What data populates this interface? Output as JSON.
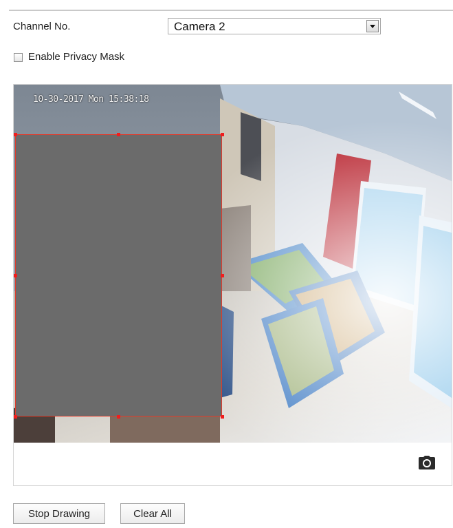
{
  "channel": {
    "label": "Channel No.",
    "value": "Camera 2"
  },
  "privacy_mask": {
    "label": "Enable Privacy Mask",
    "checked": false
  },
  "video": {
    "osd_timestamp": "10-30-2017 Mon 15:38:18"
  },
  "buttons": {
    "stop_drawing": "Stop Drawing",
    "clear_all": "Clear All"
  },
  "icons": {
    "snapshot": "camera-icon",
    "dropdown": "chevron-down-icon"
  },
  "colors": {
    "mask_fill": "#6b6b6b",
    "mask_border": "#e23a2a"
  }
}
